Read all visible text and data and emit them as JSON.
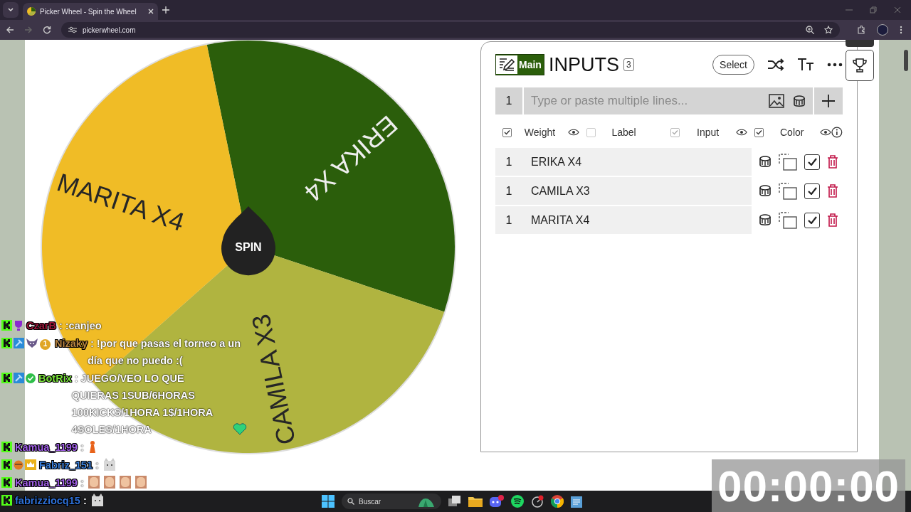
{
  "browser": {
    "tab_title": "Picker Wheel - Spin the Wheel",
    "url": "pickerwheel.com"
  },
  "wheel": {
    "button": "SPIN",
    "slices": [
      {
        "label": "ERIKA X4",
        "color": "#2b5e0b"
      },
      {
        "label": "CAMILA X3",
        "color": "#b0b440"
      },
      {
        "label": "MARITA X4",
        "color": "#f0bc26"
      }
    ]
  },
  "inputs": {
    "badge": "Main",
    "title": "INPUTS",
    "count": "3",
    "select_button": "Select",
    "new_entry": {
      "weight": "1",
      "placeholder": "Type or paste multiple lines..."
    },
    "columns": [
      {
        "label": "Weight",
        "checked": true,
        "disabled": false,
        "eye": true
      },
      {
        "label": "Label",
        "checked": false,
        "disabled": false,
        "eye": false
      },
      {
        "label": "Input",
        "checked": true,
        "disabled": true,
        "eye": true
      },
      {
        "label": "Color",
        "checked": true,
        "disabled": false,
        "eye": true
      }
    ],
    "entries": [
      {
        "weight": "1",
        "name": "ERIKA X4",
        "checked": true
      },
      {
        "weight": "1",
        "name": "CAMILA X3",
        "checked": true
      },
      {
        "weight": "1",
        "name": "MARITA X4",
        "checked": true
      }
    ]
  },
  "chat": [
    {
      "user": "CzarB",
      "color": "#a0183c",
      "badges": [
        {
          "kind": "kick"
        },
        {
          "kind": "trophy"
        }
      ],
      "text": ": :canjeo"
    },
    {
      "user": "Nizaky",
      "color": "#b8843f",
      "badges": [
        {
          "kind": "kick"
        },
        {
          "kind": "hammer"
        },
        {
          "kind": "wolf"
        },
        {
          "kind": "coin",
          "label": "1"
        }
      ],
      "text": ": !por que pasas el torneo a un día que no puedo :("
    },
    {
      "user": "BotRix",
      "color": "#7ae23c",
      "badges": [
        {
          "kind": "kick"
        },
        {
          "kind": "hammer"
        },
        {
          "kind": "verified"
        }
      ],
      "text": ": JUEGO/VEO LO QUE QUIERAS 1SUB/6HORAS 100KICKS/1HORA 1$/1HORA 4SOLES/1HORA",
      "emotes": [
        {
          "kind": "heart"
        }
      ]
    },
    {
      "user": "Kamua_1199",
      "color": "#a05ee6",
      "badges": [
        {
          "kind": "kick"
        }
      ],
      "text": ":",
      "emotes": [
        {
          "kind": "figure"
        }
      ]
    },
    {
      "user": "Fabriz_151",
      "color": "#3b7fd8",
      "badges": [
        {
          "kind": "kick"
        },
        {
          "kind": "orb"
        },
        {
          "kind": "crown"
        }
      ],
      "text": ":",
      "emotes": [
        {
          "kind": "cat"
        }
      ]
    },
    {
      "user": "Kamua_1199",
      "color": "#a05ee6",
      "badges": [
        {
          "kind": "kick"
        }
      ],
      "text": ":",
      "emotes": [
        {
          "kind": "face"
        },
        {
          "kind": "face"
        },
        {
          "kind": "face"
        },
        {
          "kind": "face"
        }
      ]
    },
    {
      "user": "fabrizziocq15",
      "color": "#2d6fd6",
      "badges": [
        {
          "kind": "kick"
        }
      ],
      "text": ":",
      "emotes": [
        {
          "kind": "cat"
        }
      ]
    }
  ],
  "taskbar": {
    "search": "Buscar"
  },
  "timer": "00:00:00"
}
